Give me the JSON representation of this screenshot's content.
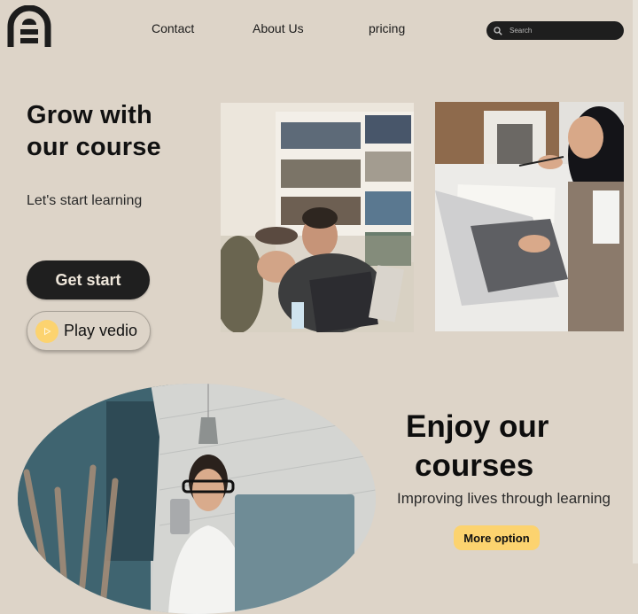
{
  "brand": {
    "logo_icon": "arch-door-logo-icon"
  },
  "nav": {
    "links": [
      {
        "label": "Contact"
      },
      {
        "label": "About Us"
      },
      {
        "label": "pricing"
      }
    ],
    "search": {
      "placeholder": "Search",
      "value": "",
      "icon": "search-icon"
    }
  },
  "hero": {
    "title_line1": "Grow with",
    "title_line2": "our course",
    "subtitle": "Let's start learning",
    "primary_button": "Get start",
    "secondary_button": "Play vedio",
    "secondary_icon": "play-icon",
    "images": [
      {
        "alt": "Students laughing around laptops in a library"
      },
      {
        "alt": "Woman taking notes beside a laptop"
      }
    ]
  },
  "courses": {
    "title_line1": "Enjoy our",
    "title_line2": "courses",
    "subtitle": "Improving lives through learning",
    "button": "More option",
    "image": {
      "alt": "Woman with glasses looking at phone near a laptop"
    }
  },
  "colors": {
    "background": "#ddd4c8",
    "dark": "#1f1f1f",
    "accent": "#fcd36f"
  }
}
